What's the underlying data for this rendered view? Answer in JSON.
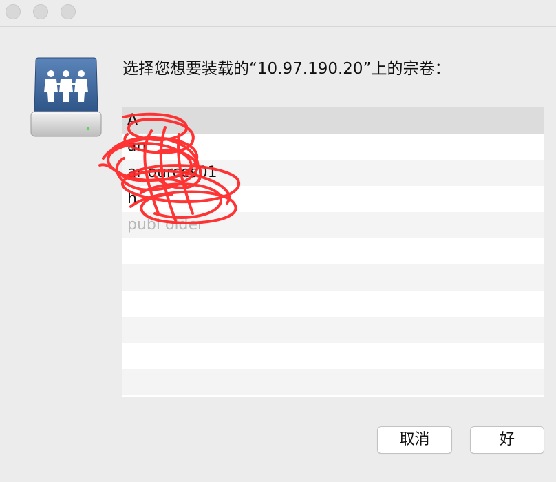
{
  "dialog": {
    "prompt": "选择您想要装载的“10.97.190.20”上的宗卷："
  },
  "volumes": [
    {
      "label": "A",
      "state": "selected"
    },
    {
      "label": "an",
      "state": "normal"
    },
    {
      "label": "ar             ources01",
      "state": "normal"
    },
    {
      "label": "h",
      "state": "normal"
    },
    {
      "label": "publ     older",
      "state": "disabled"
    },
    {
      "label": "",
      "state": "empty"
    },
    {
      "label": "",
      "state": "empty"
    },
    {
      "label": "",
      "state": "empty"
    },
    {
      "label": "",
      "state": "empty"
    },
    {
      "label": "",
      "state": "empty"
    },
    {
      "label": "",
      "state": "empty"
    }
  ],
  "buttons": {
    "cancel": "取消",
    "ok": "好"
  },
  "icons": {
    "server": "network-server-icon",
    "annotation": "red-scribble-redaction"
  },
  "colors": {
    "window_bg": "#ececec",
    "selected_row": "#dcdcdc",
    "alt_row": "#f4f4f4",
    "disabled_text": "#b8b8b8",
    "scribble": "#ff2a2a",
    "icon_blue": "#3f6aa0"
  }
}
